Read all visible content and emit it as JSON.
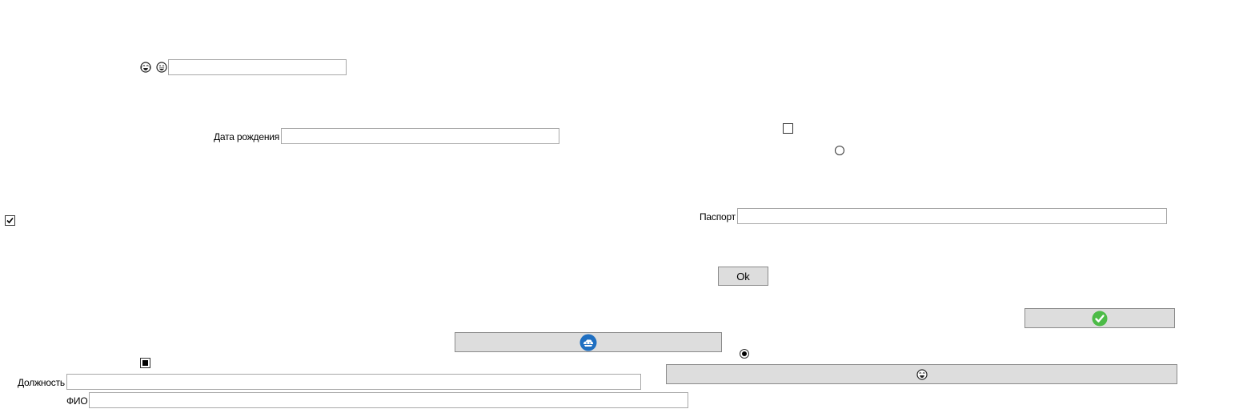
{
  "form": {
    "top_input": {
      "value": "",
      "placeholder": ""
    },
    "birth_date": {
      "label": "Дата рождения",
      "value": ""
    },
    "passport": {
      "label": "Паспорт",
      "value": ""
    },
    "position": {
      "label": "Должность",
      "value": ""
    },
    "full_name": {
      "label": "ФИО",
      "value": ""
    },
    "ok_button": {
      "label": "Ok"
    }
  },
  "controls": {
    "checkbox_top_right": {
      "checked": false
    },
    "radio_top_right": {
      "checked": false
    },
    "checkbox_left": {
      "checked": true
    },
    "checkbox_bottom_left": {
      "state": "indeterminate"
    },
    "radio_bottom": {
      "checked": true
    }
  },
  "icons": {
    "top_icon_1": "face-with-tears-of-joy-icon",
    "top_icon_2": "grinning-face-icon",
    "check_button_icon": "green-checkmark-icon",
    "blue_button_icon": "blue-cloud-logo-icon",
    "emoji_button_icon": "face-with-tears-of-joy-icon"
  },
  "colors": {
    "button_bg": "#dddddd",
    "check_green": "#4cbb47",
    "logo_blue": "#1f6fc1"
  }
}
